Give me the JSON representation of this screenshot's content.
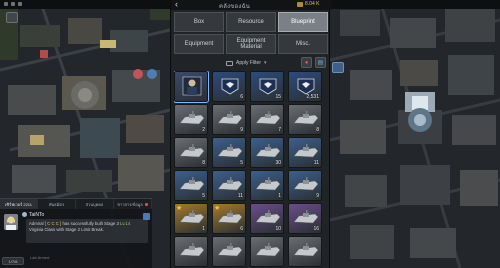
{
  "header": {
    "title": "คลังของฉัน",
    "resource_value": "8.04 K",
    "back_icon": "chevron-left-icon",
    "resource_icon": "coin-icon"
  },
  "tabs": [
    {
      "label": "Box",
      "active": false
    },
    {
      "label": "Resource",
      "active": false
    },
    {
      "label": "Blueprint",
      "active": true
    },
    {
      "label": "Equipment",
      "active": false
    },
    {
      "label": "Equipment Material",
      "active": false
    },
    {
      "label": "Misc.",
      "active": false
    }
  ],
  "filter": {
    "label": "Apply Filter",
    "filter_icon": "filter-icon",
    "sort_icon": "sort-icon",
    "view_icon": "grid-view-icon"
  },
  "items": [
    {
      "type": "portrait",
      "count": "",
      "star": false,
      "bg": "#3a4a6a"
    },
    {
      "type": "badge",
      "count": "6",
      "star": false,
      "bg": "#2d4b7c"
    },
    {
      "type": "badge",
      "count": "15",
      "star": false,
      "bg": "#2d4b7c"
    },
    {
      "type": "badge",
      "count": "2,531",
      "star": false,
      "bg": "#2d4b7c"
    },
    {
      "type": "ship",
      "count": "2",
      "star": false,
      "bg": "#6a6e73"
    },
    {
      "type": "ship",
      "count": "9",
      "star": false,
      "bg": "#6a6e73"
    },
    {
      "type": "ship",
      "count": "7",
      "star": false,
      "bg": "#6a6e73"
    },
    {
      "type": "ship",
      "count": "8",
      "star": false,
      "bg": "#6a6e73"
    },
    {
      "type": "ship",
      "count": "8",
      "star": false,
      "bg": "#6a6e73"
    },
    {
      "type": "ship",
      "count": "5",
      "star": false,
      "bg": "#3c5f8e"
    },
    {
      "type": "ship",
      "count": "30",
      "star": false,
      "bg": "#3c5f8e"
    },
    {
      "type": "ship",
      "count": "11",
      "star": false,
      "bg": "#3c5f8e"
    },
    {
      "type": "ship",
      "count": "5",
      "star": false,
      "bg": "#3c5f8e"
    },
    {
      "type": "ship",
      "count": "11",
      "star": false,
      "bg": "#3c5f8e"
    },
    {
      "type": "ship",
      "count": "1",
      "star": false,
      "bg": "#3c5f8e"
    },
    {
      "type": "ship",
      "count": "9",
      "star": false,
      "bg": "#3c5f8e"
    },
    {
      "type": "ship",
      "count": "1",
      "star": true,
      "bg": "#a57a2a"
    },
    {
      "type": "ship",
      "count": "6",
      "star": true,
      "bg": "#a57a2a"
    },
    {
      "type": "ship",
      "count": "10",
      "star": false,
      "bg": "#6a4d8c"
    },
    {
      "type": "ship",
      "count": "16",
      "star": false,
      "bg": "#6a4d8c"
    },
    {
      "type": "ship",
      "count": "",
      "star": false,
      "bg": "#6a6e73"
    },
    {
      "type": "ship",
      "count": "",
      "star": false,
      "bg": "#6a6e73"
    },
    {
      "type": "ship",
      "count": "",
      "star": false,
      "bg": "#6a6e73"
    },
    {
      "type": "ship",
      "count": "",
      "star": false,
      "bg": "#6a6e73"
    }
  ],
  "chat": {
    "tabs": [
      {
        "label": "เซิร์ฟเวอร์ 2211",
        "active": true,
        "badge": false
      },
      {
        "label": "พันธมิตร",
        "active": false,
        "badge": false
      },
      {
        "label": "ส่วนบุคคล",
        "active": false,
        "badge": false
      },
      {
        "label": "ข่าวสาร/ข้อมูล",
        "active": false,
        "badge": true
      }
    ],
    "sender": "TaiNTo",
    "message_prefix": "Admiral",
    "message_player": "[ C C C ]",
    "message_mid": "has successfully built Stage 3",
    "message_level": "Lv.14",
    "message_rest": "Virginia Class with Stage 2 Limit Break.",
    "footer": "Lab Armed",
    "side_button": "1/7/6"
  },
  "colors": {
    "panel_bg": "#212427",
    "tab_active": "#7b8087",
    "accent_gold": "#f0c24a"
  }
}
